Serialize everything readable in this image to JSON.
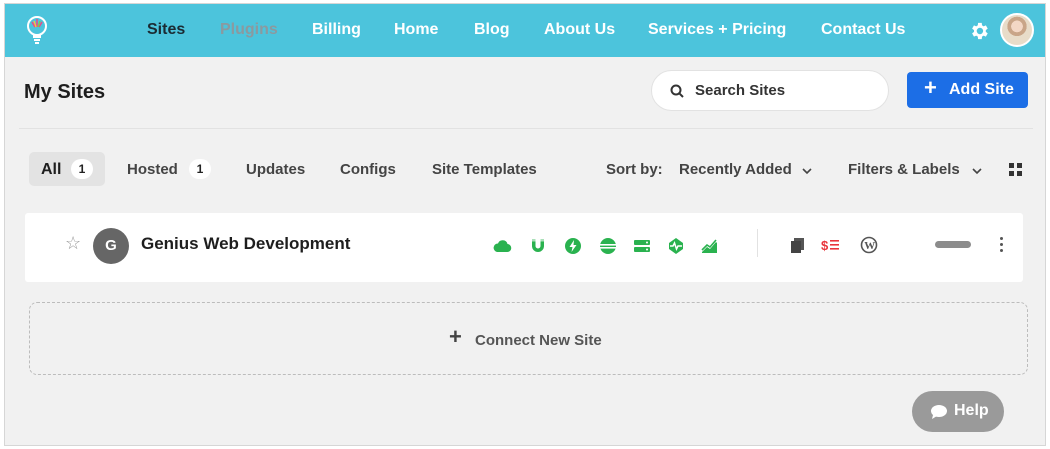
{
  "nav": {
    "items": [
      {
        "label": "Sites",
        "state": "active"
      },
      {
        "label": "Plugins",
        "state": "muted"
      },
      {
        "label": "Billing",
        "state": "normal"
      },
      {
        "label": "Home",
        "state": "normal"
      },
      {
        "label": "Blog",
        "state": "normal"
      },
      {
        "label": "About Us",
        "state": "normal"
      },
      {
        "label": "Services + Pricing",
        "state": "normal"
      },
      {
        "label": "Contact Us",
        "state": "normal"
      }
    ],
    "icons": {
      "logo": "lightbulb-logo-icon",
      "settings": "gear-icon",
      "profile": "user-avatar"
    }
  },
  "header": {
    "title": "My Sites",
    "search_label": "Search Sites",
    "add_site_label": "Add Site"
  },
  "filters": {
    "tabs": [
      {
        "label": "All",
        "count": "1",
        "selected": true
      },
      {
        "label": "Hosted",
        "count": "1",
        "selected": false
      },
      {
        "label": "Updates"
      },
      {
        "label": "Configs"
      },
      {
        "label": "Site Templates"
      }
    ],
    "sort_label": "Sort by:",
    "sort_value": "Recently Added",
    "filters_label": "Filters & Labels"
  },
  "site": {
    "initial": "G",
    "name": "Genius Web Development",
    "status_icons": [
      "cloud-icon",
      "shield-magnet-icon",
      "bolt-icon",
      "database-icon",
      "server-icon",
      "uptime-pulse-icon",
      "performance-chart-icon"
    ],
    "action_icons": [
      "copy-icon",
      "billing-list-icon",
      "wordpress-icon"
    ],
    "status_color": "#2ab24f",
    "billing_color": "#e8353c"
  },
  "connect": {
    "label": "Connect New Site"
  },
  "help": {
    "label": "Help"
  },
  "colors": {
    "nav_bg": "#4cc4dc",
    "primary": "#1c6ee6",
    "page_bg": "#f1f1f1"
  }
}
